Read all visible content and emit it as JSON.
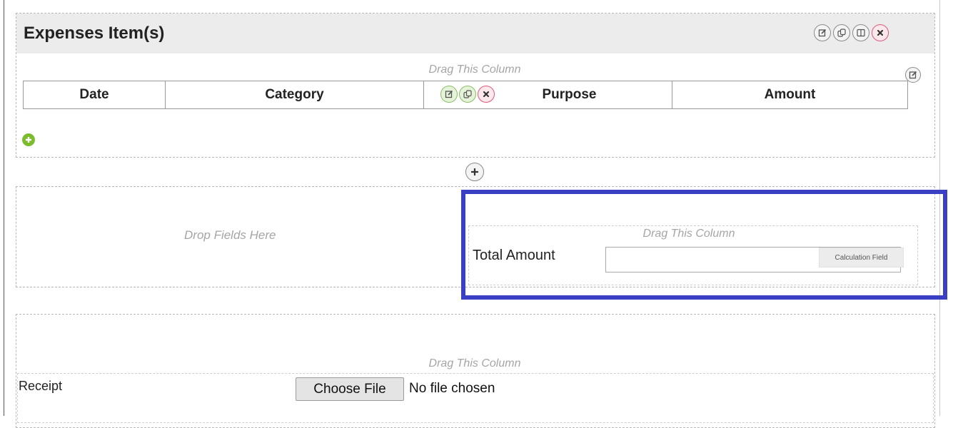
{
  "section": {
    "title": "Expenses Item(s)",
    "toolbar_icons": [
      "edit-icon",
      "copy-icon",
      "columns-icon",
      "close-icon"
    ]
  },
  "grid": {
    "drag_label": "Drag This Column",
    "columns": [
      "Date",
      "Category",
      "Purpose",
      "Amount"
    ],
    "add_row_icon": "add-row-icon"
  },
  "layout_row": {
    "drop_label": "Drop Fields Here",
    "drag_label": "Drag This Column",
    "total_field": {
      "label": "Total Amount",
      "value": "",
      "badge": "Calculation Field"
    }
  },
  "receipt_row": {
    "drag_label": "Drag This Column",
    "label": "Receipt",
    "button_label": "Choose File",
    "status": "No file chosen"
  },
  "colors": {
    "highlight": "#3a3fc4",
    "header_bg": "#ececec",
    "accent_green": "#7dbb2f",
    "accent_red": "#e0577a"
  }
}
